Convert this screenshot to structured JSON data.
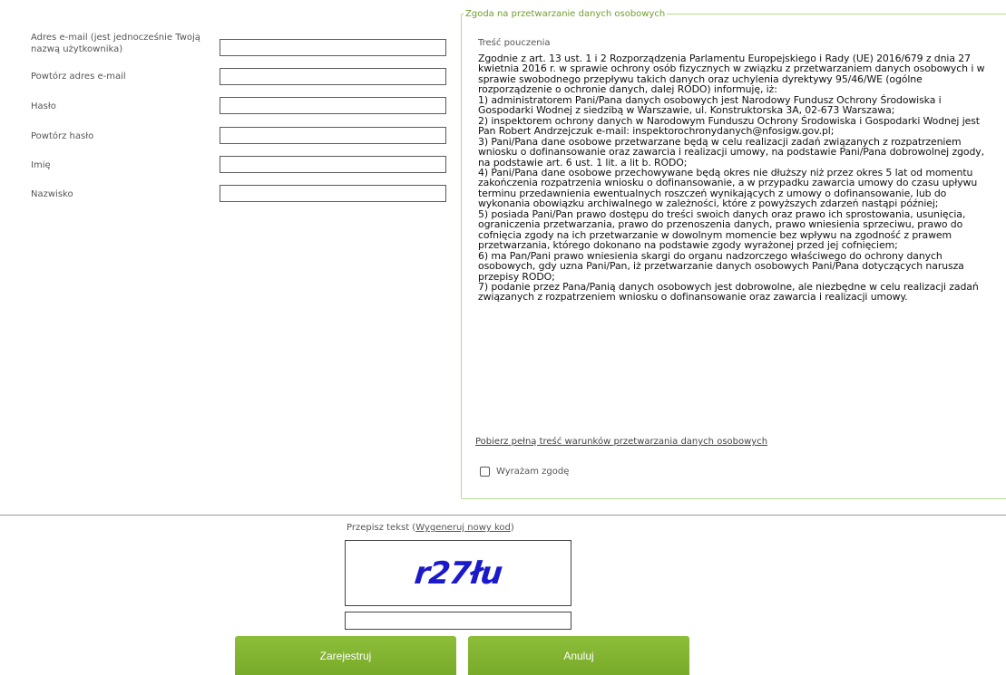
{
  "form": {
    "fields": [
      {
        "label": "Adres e-mail (jest jednocześnie Twoją nazwą użytkownika)",
        "value": ""
      },
      {
        "label": "Powtórz adres e-mail",
        "value": ""
      },
      {
        "label": "Hasło",
        "value": ""
      },
      {
        "label": "Powtórz hasło",
        "value": ""
      },
      {
        "label": "Imię",
        "value": ""
      },
      {
        "label": "Nazwisko",
        "value": ""
      }
    ]
  },
  "consent": {
    "legend": "Zgoda na przetwarzanie danych osobowych",
    "heading": "Treść pouczenia",
    "text": "Zgodnie z art. 13 ust. 1 i 2 Rozporządzenia Parlamentu Europejskiego i Rady (UE) 2016/679 z dnia 27 kwietnia 2016 r. w sprawie ochrony osób fizycznych w związku z przetwarzaniem danych osobowych i w sprawie swobodnego przepływu takich danych oraz uchylenia dyrektywy 95/46/WE (ogólne rozporządzenie o ochronie danych, dalej RODO) informuję, iż:\n1) administratorem Pani/Pana danych osobowych jest Narodowy Fundusz Ochrony Środowiska i Gospodarki Wodnej z siedzibą w Warszawie, ul. Konstruktorska 3A, 02-673 Warszawa;\n2) inspektorem ochrony danych w Narodowym Funduszu Ochrony Środowiska i Gospodarki Wodnej jest Pan Robert Andrzejczuk e-mail: inspektorochronydanych@nfosigw.gov.pl;\n3) Pani/Pana dane osobowe przetwarzane będą w celu realizacji zadań związanych z rozpatrzeniem wniosku o dofinansowanie oraz zawarcia i realizacji umowy, na podstawie Pani/Pana dobrowolnej zgody, na podstawie art. 6 ust. 1 lit. a lit b. RODO;\n4) Pani/Pana dane osobowe przechowywane będą okres nie dłuższy niż przez okres 5 lat od momentu zakończenia rozpatrzenia wniosku o dofinansowanie, a w przypadku zawarcia umowy do czasu upływu terminu przedawnienia ewentualnych roszczeń wynikających z umowy o dofinansowanie, lub do wykonania obowiązku archiwalnego w zależności, które z powyższych zdarzeń nastąpi później;\n5) posiada Pani/Pan prawo dostępu do treści swoich danych oraz prawo ich sprostowania, usunięcia, ograniczenia przetwarzania, prawo do przenoszenia danych, prawo wniesienia sprzeciwu, prawo do cofnięcia zgody na ich przetwarzanie w dowolnym momencie bez wpływu na zgodność z prawem przetwarzania, którego dokonano na podstawie zgody wyrażonej przed jej cofnięciem;\n6) ma Pan/Pani prawo wniesienia skargi do organu nadzorczego właściwego do ochrony danych osobowych, gdy uzna Pani/Pan, iż przetwarzanie danych osobowych Pani/Pana dotyczących narusza przepisy RODO;\n7) podanie przez Pana/Panią danych osobowych jest dobrowolne, ale niezbędne w celu realizacji zadań związanych z rozpatrzeniem wniosku o dofinansowanie oraz zawarcia i realizacji umowy.",
    "download_link": "Pobierz pełną treść warunków przetwarzania danych osobowych",
    "checkbox_label": "Wyrażam zgodę",
    "checked": false
  },
  "captcha": {
    "caption_prefix": "Przepisz tekst (",
    "regenerate_link": "Wygeneruj nowy kod",
    "caption_suffix": ")",
    "image_text": "r27łu",
    "input_value": ""
  },
  "buttons": {
    "register": "Zarejestruj",
    "cancel": "Anuluj"
  },
  "colors": {
    "accent": "#7fb030",
    "legend": "#6f9f2c",
    "fieldset_border": "#b6d88a",
    "captcha_text": "#1a1acc"
  }
}
